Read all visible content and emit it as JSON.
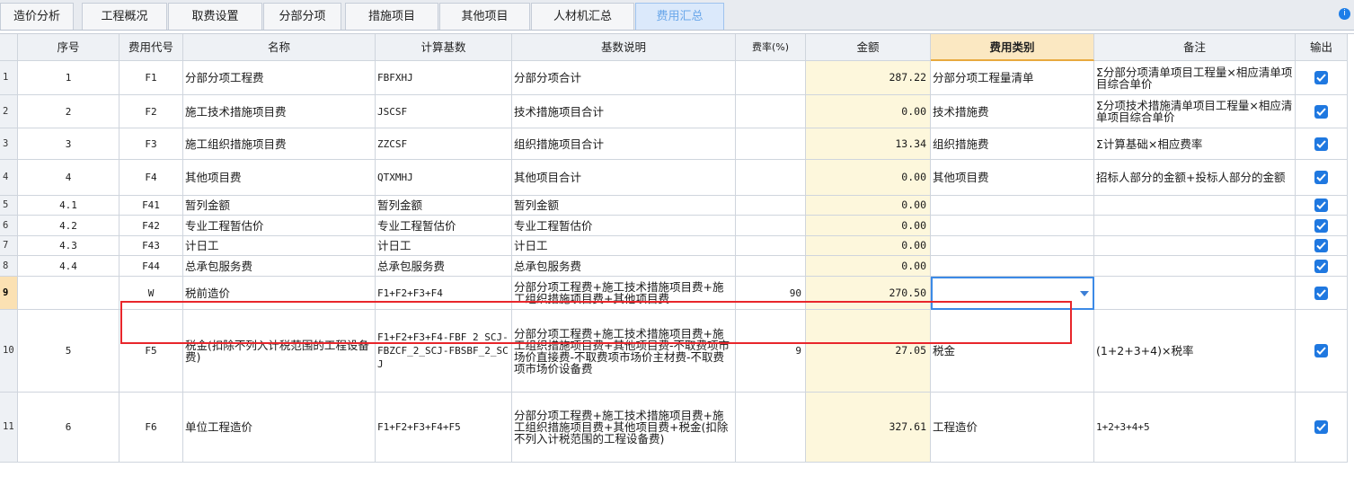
{
  "tabs": [
    {
      "label": "造价分析",
      "active": false
    },
    {
      "label": "工程概况",
      "active": false
    },
    {
      "label": "取费设置",
      "active": false
    },
    {
      "label": "分部分项",
      "active": false
    },
    {
      "label": "措施项目",
      "active": false
    },
    {
      "label": "其他项目",
      "active": false
    },
    {
      "label": "人材机汇总",
      "active": false
    },
    {
      "label": "费用汇总",
      "active": true
    }
  ],
  "headers": {
    "seq": "序号",
    "code": "费用代号",
    "name": "名称",
    "base": "计算基数",
    "base_desc": "基数说明",
    "rate": "费率(%)",
    "amount": "金额",
    "category": "费用类别",
    "remark": "备注",
    "output": "输出"
  },
  "rows": [
    {
      "num": "1",
      "seq": "1",
      "code": "F1",
      "name": "分部分项工程费",
      "base": "FBFXHJ",
      "base_desc": "分部分项合计",
      "rate": "",
      "amount": "287.22",
      "category": "分部分项工程量清单",
      "remark": "Σ分部分项清单项目工程量×相应清单项目综合单价",
      "output": true
    },
    {
      "num": "2",
      "seq": "2",
      "code": "F2",
      "name": "施工技术措施项目费",
      "base": "JSCSF",
      "base_desc": "技术措施项目合计",
      "rate": "",
      "amount": "0.00",
      "category": "技术措施费",
      "remark": "Σ分项技术措施清单项目工程量×相应清单项目综合单价",
      "output": true
    },
    {
      "num": "3",
      "seq": "3",
      "code": "F3",
      "name": "施工组织措施项目费",
      "base": "ZZCSF",
      "base_desc": "组织措施项目合计",
      "rate": "",
      "amount": "13.34",
      "category": "组织措施费",
      "remark": "Σ计算基础×相应费率",
      "output": true
    },
    {
      "num": "4",
      "seq": "4",
      "code": "F4",
      "name": "其他项目费",
      "base": "QTXMHJ",
      "base_desc": "其他项目合计",
      "rate": "",
      "amount": "0.00",
      "category": "其他项目费",
      "remark": "招标人部分的金额+投标人部分的金额",
      "output": true
    },
    {
      "num": "5",
      "seq": "4.1",
      "code": "F41",
      "name": "暂列金额",
      "base": "暂列金额",
      "base_desc": "暂列金额",
      "rate": "",
      "amount": "0.00",
      "category": "",
      "remark": "",
      "output": true
    },
    {
      "num": "6",
      "seq": "4.2",
      "code": "F42",
      "name": "专业工程暂估价",
      "base": "专业工程暂估价",
      "base_desc": "专业工程暂估价",
      "rate": "",
      "amount": "0.00",
      "category": "",
      "remark": "",
      "output": true
    },
    {
      "num": "7",
      "seq": "4.3",
      "code": "F43",
      "name": "计日工",
      "base": "计日工",
      "base_desc": "计日工",
      "rate": "",
      "amount": "0.00",
      "category": "",
      "remark": "",
      "output": true
    },
    {
      "num": "8",
      "seq": "4.4",
      "code": "F44",
      "name": "总承包服务费",
      "base": "总承包服务费",
      "base_desc": "总承包服务费",
      "rate": "",
      "amount": "0.00",
      "category": "",
      "remark": "",
      "output": true
    },
    {
      "num": "9",
      "seq": "",
      "code": "W",
      "name": "税前造价",
      "base": "F1+F2+F3+F4",
      "base_desc": "分部分项工程费+施工技术措施项目费+施工组织措施项目费+其他项目费",
      "rate": "90",
      "amount": "270.50",
      "category": "",
      "remark": "",
      "output": true
    },
    {
      "num": "10",
      "seq": "5",
      "code": "F5",
      "name": "税金(扣除不列入计税范围的工程设备费)",
      "base": "F1+F2+F3+F4-FBF_2_SCJ-FBZCF_2_SCJ-FBSBF_2_SCJ",
      "base_desc": "分部分项工程费+施工技术措施项目费+施工组织措施项目费+其他项目费-不取费项市场价直接费-不取费项市场价主材费-不取费项市场价设备费",
      "rate": "9",
      "amount": "27.05",
      "category": "税金",
      "remark": "(1+2+3+4)×税率",
      "output": true
    },
    {
      "num": "11",
      "seq": "6",
      "code": "F6",
      "name": "单位工程造价",
      "base": "F1+F2+F3+F4+F5",
      "base_desc": "分部分项工程费+施工技术措施项目费+施工组织措施项目费+其他项目费+税金(扣除不列入计税范围的工程设备费)",
      "rate": "",
      "amount": "327.61",
      "category": "工程造价",
      "remark": "1+2+3+4+5",
      "output": true
    }
  ],
  "selected_row": "9"
}
